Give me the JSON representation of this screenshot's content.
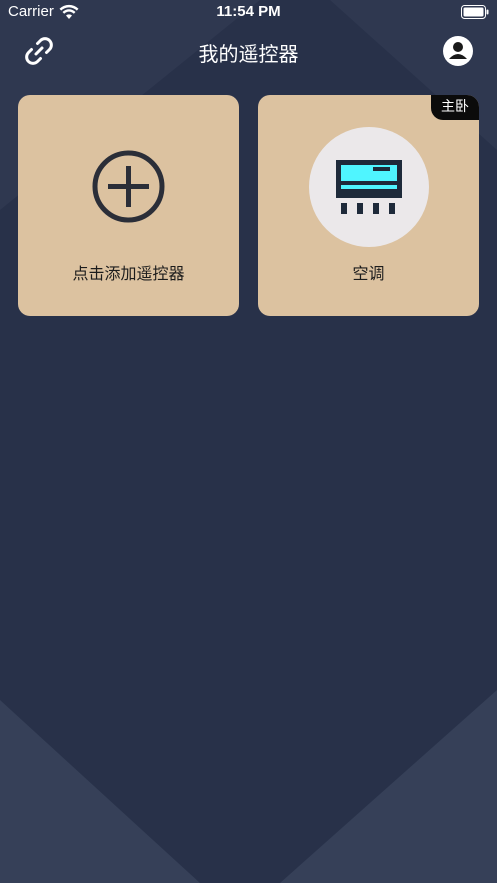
{
  "status_bar": {
    "carrier": "Carrier",
    "time": "11:54 PM"
  },
  "header": {
    "title": "我的遥控器"
  },
  "cards": {
    "add": {
      "label": "点击添加遥控器"
    },
    "device": {
      "label": "空调",
      "room": "主卧"
    }
  },
  "icons": {
    "link": "link-icon",
    "profile": "profile-icon",
    "add": "plus-circle-icon",
    "device": "air-conditioner-icon"
  },
  "colors": {
    "background": "#283149",
    "card": "#dcc2a0",
    "device_circle": "#ebe8ea",
    "ac_screen": "#4ff5ff",
    "badge": "#0b0b0b"
  }
}
